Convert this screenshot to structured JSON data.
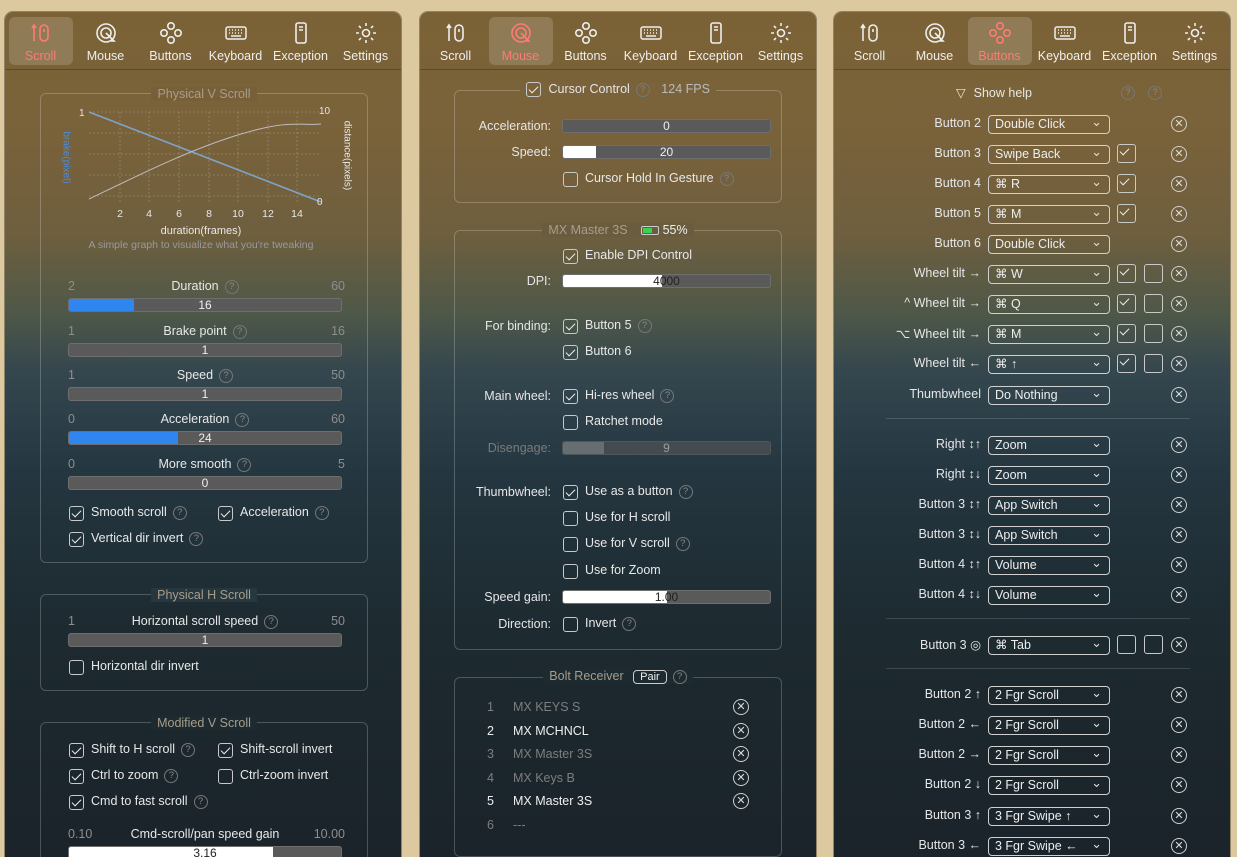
{
  "tabs": [
    {
      "label": "Scroll",
      "icon": "scroll-icon"
    },
    {
      "label": "Mouse",
      "icon": "mouse-icon"
    },
    {
      "label": "Buttons",
      "icon": "buttons-icon"
    },
    {
      "label": "Keyboard",
      "icon": "keyboard-icon"
    },
    {
      "label": "Exception",
      "icon": "exception-icon"
    },
    {
      "label": "Settings",
      "icon": "settings-icon"
    }
  ],
  "accent": "#ff7b74",
  "scroll": {
    "physical_v": {
      "title": "Physical V Scroll",
      "graph": {
        "y_left_label": "brake(pixel)",
        "y_right_label": "distance(pixels)",
        "x_label": "duration(frames)",
        "caption": "A simple graph to visualize what you're tweaking",
        "left_top": "1",
        "right_top": "10",
        "right_bottom": "0",
        "xticks": [
          "2",
          "4",
          "6",
          "8",
          "10",
          "12",
          "14"
        ]
      },
      "sliders": [
        {
          "label": "Duration",
          "min": "2",
          "max": "60",
          "value": "16",
          "fraction": 0.24
        },
        {
          "label": "Brake point",
          "min": "1",
          "max": "16",
          "value": "1",
          "fraction": 0
        },
        {
          "label": "Speed",
          "min": "1",
          "max": "50",
          "value": "1",
          "fraction": 0
        },
        {
          "label": "Acceleration",
          "min": "0",
          "max": "60",
          "value": "24",
          "fraction": 0.4
        },
        {
          "label": "More smooth",
          "min": "0",
          "max": "5",
          "value": "0",
          "fraction": 0
        }
      ],
      "checks": {
        "smooth": "Smooth scroll",
        "accel": "Acceleration",
        "vinvert": "Vertical dir invert"
      }
    },
    "physical_h": {
      "title": "Physical H Scroll",
      "slider": {
        "label": "Horizontal scroll speed",
        "min": "1",
        "max": "50",
        "value": "1"
      },
      "invert": "Horizontal dir invert"
    },
    "modified_v": {
      "title": "Modified V Scroll",
      "shift_h": "Shift to H scroll",
      "shift_inv": "Shift-scroll invert",
      "ctrl_zoom": "Ctrl to zoom",
      "ctrl_inv": "Ctrl-zoom invert",
      "cmd_fast": "Cmd to fast scroll",
      "gain": {
        "label": "Cmd-scroll/pan speed gain",
        "min": "0.10",
        "max": "10.00",
        "value": "3.16",
        "fraction": 0.75
      }
    }
  },
  "mouse": {
    "cursor_control": "Cursor Control",
    "fps": "124 FPS",
    "accel_label": "Acceleration:",
    "accel_value": "0",
    "speed_label": "Speed:",
    "speed_value": "20",
    "speed_fraction": 0.16,
    "hold": "Cursor Hold In Gesture",
    "device": "MX Master 3S",
    "battery": "55%",
    "enable_dpi": "Enable DPI Control",
    "dpi_label": "DPI:",
    "dpi_value": "4000",
    "dpi_fraction": 0.48,
    "binding_label": "For binding:",
    "btn5": "Button 5",
    "btn6": "Button 6",
    "main_wheel_label": "Main wheel:",
    "hires": "Hi-res wheel",
    "ratchet": "Ratchet mode",
    "disengage_label": "Disengage:",
    "disengage_value": "9",
    "disengage_fraction": 0.2,
    "thumb_label": "Thumbwheel:",
    "as_button": "Use as a button",
    "h_scroll": "Use for H scroll",
    "v_scroll": "Use for V scroll",
    "zoom": "Use for Zoom",
    "gain_label": "Speed gain:",
    "gain_value": "1.00",
    "gain_fraction": 0.5,
    "direction_label": "Direction:",
    "invert": "Invert",
    "receiver_title": "Bolt Receiver",
    "pair": "Pair",
    "receivers": [
      {
        "n": "1",
        "name": "MX KEYS S"
      },
      {
        "n": "2",
        "name": "MX MCHNCL"
      },
      {
        "n": "3",
        "name": "MX Master 3S"
      },
      {
        "n": "4",
        "name": "MX Keys B"
      },
      {
        "n": "5",
        "name": "MX Master 3S"
      },
      {
        "n": "6",
        "name": "---"
      }
    ]
  },
  "buttons": {
    "show_help": "Show help",
    "rows": [
      {
        "label": "Button 2",
        "value": "Double Click"
      },
      {
        "label": "Button 3",
        "value": "Swipe Back"
      },
      {
        "label": "Button 4",
        "value": "⌘ R"
      },
      {
        "label": "Button 5",
        "value": "⌘ M"
      },
      {
        "label": "Button 6",
        "value": "Double Click"
      },
      {
        "label": "Wheel tilt →",
        "value": "⌘ W"
      },
      {
        "label": "^ Wheel tilt →",
        "value": "⌘ Q"
      },
      {
        "label": "⌥ Wheel tilt →",
        "value": "⌘ M"
      },
      {
        "label": "Wheel tilt ←",
        "value": "⌘ ↑"
      },
      {
        "label": "Thumbwheel",
        "value": "Do Nothing"
      },
      {
        "label": "Right ↕↑",
        "value": "Zoom"
      },
      {
        "label": "Right ↕↓",
        "value": "Zoom"
      },
      {
        "label": "Button 3 ↕↑",
        "value": "App Switch"
      },
      {
        "label": "Button 3 ↕↓",
        "value": "App Switch"
      },
      {
        "label": "Button 4 ↕↑",
        "value": "Volume"
      },
      {
        "label": "Button 4 ↕↓",
        "value": "Volume"
      },
      {
        "label": "Button 3 ◎",
        "value": "⌘ Tab"
      },
      {
        "label": "Button 2 ↑",
        "value": "2 Fgr Scroll"
      },
      {
        "label": "Button 2 ←",
        "value": "2 Fgr Scroll"
      },
      {
        "label": "Button 2 →",
        "value": "2 Fgr Scroll"
      },
      {
        "label": "Button 2 ↓",
        "value": "2 Fgr Scroll"
      },
      {
        "label": "Button 3 ↑",
        "value": "3 Fgr Swipe ↑"
      },
      {
        "label": "Button 3 ←",
        "value": "3 Fgr Swipe ←"
      }
    ]
  }
}
